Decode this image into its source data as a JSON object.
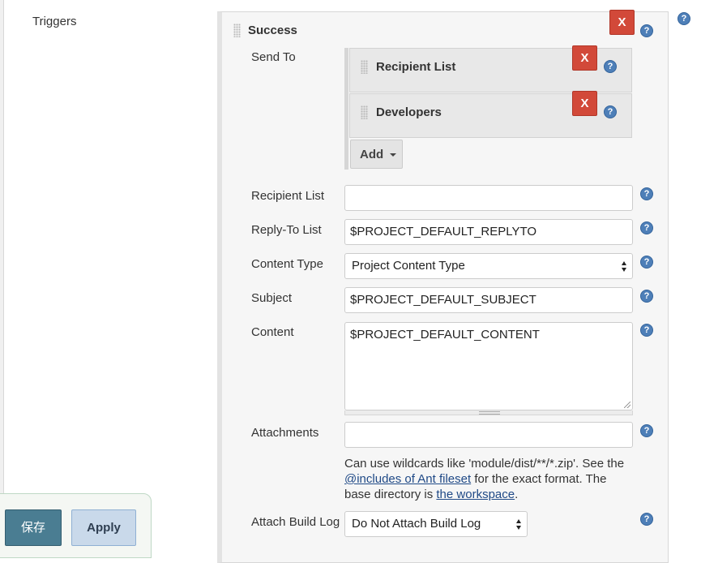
{
  "triggers_label": "Triggers",
  "section": {
    "title": "Success",
    "remove_label": "X"
  },
  "send_to": {
    "label": "Send To",
    "items": [
      {
        "title": "Recipient List",
        "remove_label": "X"
      },
      {
        "title": "Developers",
        "remove_label": "X"
      }
    ],
    "add_label": "Add"
  },
  "fields": {
    "recipient_list": {
      "label": "Recipient List",
      "value": ""
    },
    "reply_to": {
      "label": "Reply-To List",
      "value": "$PROJECT_DEFAULT_REPLYTO"
    },
    "content_type": {
      "label": "Content Type",
      "value": "Project Content Type"
    },
    "subject": {
      "label": "Subject",
      "value": "$PROJECT_DEFAULT_SUBJECT"
    },
    "content": {
      "label": "Content",
      "value": "$PROJECT_DEFAULT_CONTENT"
    },
    "attachments": {
      "label": "Attachments",
      "value": "",
      "hint_1": "Can use wildcards like 'module/dist/**/*.zip'. See the",
      "hint_link_1": "@includes of Ant fileset",
      "hint_2": " for the exact format. The base directory is ",
      "hint_link_2": "the workspace",
      "hint_3": "."
    },
    "attach_build_log": {
      "label": "Attach Build Log",
      "value": "Do Not Attach Build Log"
    }
  },
  "help_glyph": "?",
  "icons": {
    "help": "help-icon",
    "remove": "remove-x",
    "grip": "drag-handle",
    "dropdown": "caret-down-icon"
  },
  "buttons": {
    "save": "保存",
    "apply": "Apply"
  },
  "colors": {
    "remove_red": "#d24939",
    "help_blue": "#4e7fb8",
    "save_teal": "#4a7d92",
    "apply_blue": "#c9d9ea"
  }
}
